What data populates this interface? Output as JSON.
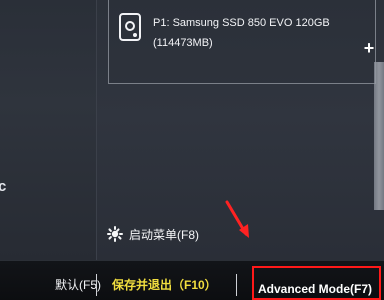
{
  "left_panel": {
    "partial_text": "c"
  },
  "disk": {
    "name": "P1: Samsung SSD 850 EVO 120GB",
    "size": "(114473MB)",
    "icon": "disk-icon"
  },
  "scroll": {
    "plus_icon": "+"
  },
  "boot_menu": {
    "icon": "boot-menu-icon",
    "label": "启动菜单(F8)"
  },
  "footer": {
    "default_label": "默认(F5)",
    "save_exit_label": "保存并退出（F10）",
    "advanced_label": "Advanced Mode(F7)"
  },
  "annotation": {
    "arrow_icon": "red-arrow-icon",
    "box_color": "#ff1919"
  }
}
